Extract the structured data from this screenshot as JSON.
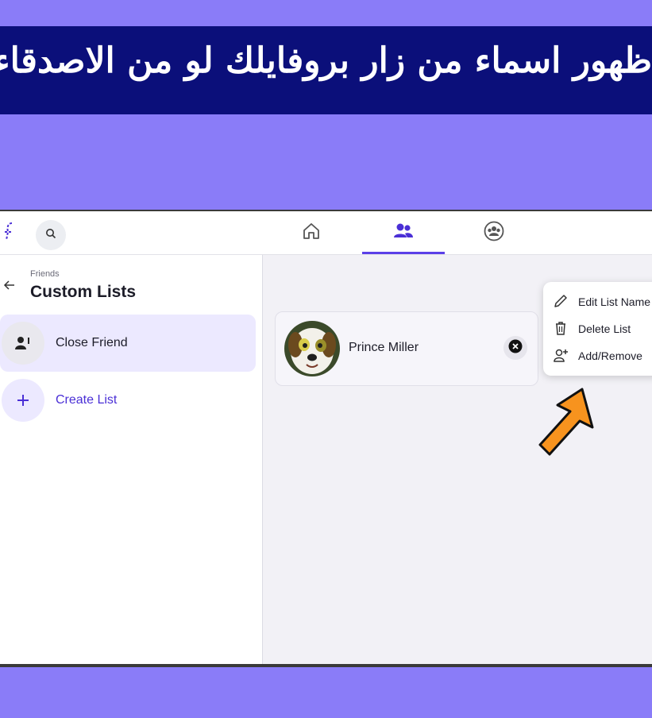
{
  "banner": {
    "text": "ظهور اسماء من زار بروفايلك لو من الاصدقاء"
  },
  "topbar": {
    "logo": "brand-logo",
    "search_icon": "search-icon",
    "tabs": [
      {
        "name": "home-tab",
        "icon": "home-icon",
        "active": false
      },
      {
        "name": "friends-tab",
        "icon": "friends-icon",
        "active": true
      },
      {
        "name": "groups-tab",
        "icon": "groups-icon",
        "active": false
      }
    ]
  },
  "sidebar": {
    "breadcrumb": "Friends",
    "title": "Custom Lists",
    "items": [
      {
        "label": "Close Friend",
        "icon": "user-list-icon",
        "selected": true
      },
      {
        "label": "Create List",
        "icon": "plus-icon",
        "selected": false
      }
    ]
  },
  "friend_card": {
    "name": "Prince Miller",
    "remove_icon": "close-circle-icon"
  },
  "context_menu": {
    "items": [
      {
        "label": "Edit List Name",
        "icon": "pencil-icon"
      },
      {
        "label": "Delete List",
        "icon": "trash-icon"
      },
      {
        "label": "Add/Remove",
        "icon": "add-user-icon"
      }
    ]
  },
  "colors": {
    "accent": "#5b40e8",
    "banner_bg": "#0b0f7a",
    "frame_bg": "#8a7cf8",
    "pointer": "#f7931e"
  }
}
